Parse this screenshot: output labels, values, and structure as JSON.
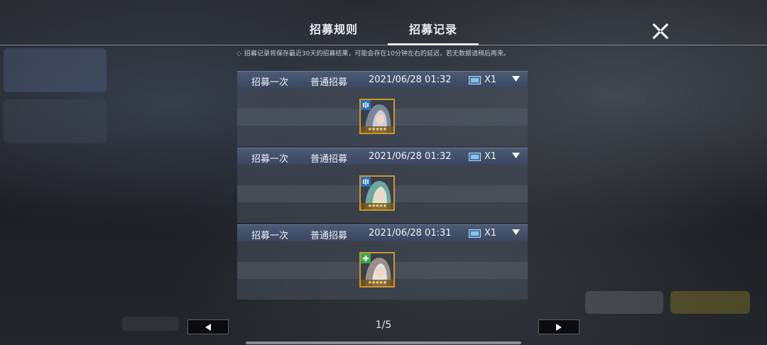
{
  "tabs": [
    {
      "label": "招募规则",
      "active": false
    },
    {
      "label": "招募记录",
      "active": true
    }
  ],
  "notice": {
    "text": "招募记录将保存最近30天的招募结果，可能会存在10分钟左右的延迟，若无数据请稍后再来。"
  },
  "records": [
    {
      "type": "招募一次",
      "pool": "普通招募",
      "time": "2021/06/28 01:32",
      "count": "X1",
      "card": {
        "badge_icon": "blue-class-icon",
        "portrait": "silver-hair-character",
        "rarity_color": "#c9962f"
      }
    },
    {
      "type": "招募一次",
      "pool": "普通招募",
      "time": "2021/06/28 01:32",
      "count": "X1",
      "card": {
        "badge_icon": "blue-class-icon",
        "portrait": "green-hair-character",
        "rarity_color": "#c9962f"
      }
    },
    {
      "type": "招募一次",
      "pool": "普通招募",
      "time": "2021/06/28 01:31",
      "count": "X1",
      "card": {
        "badge_icon": "green-plus-icon",
        "portrait": "white-hair-character",
        "rarity_color": "#c9962f"
      }
    }
  ],
  "pagination": {
    "current": 1,
    "total": 5,
    "label": "1/5"
  },
  "icons": {
    "close": "close-x-icon",
    "prev": "triangle-left-icon",
    "next": "triangle-right-icon",
    "expand": "triangle-down-icon",
    "ticket": "recruit-ticket-icon"
  },
  "colors": {
    "header_bar": "#4d5a73",
    "card_border": "#c9962f",
    "badge_blue": "#2f6fb6",
    "badge_green": "#39a84b"
  }
}
